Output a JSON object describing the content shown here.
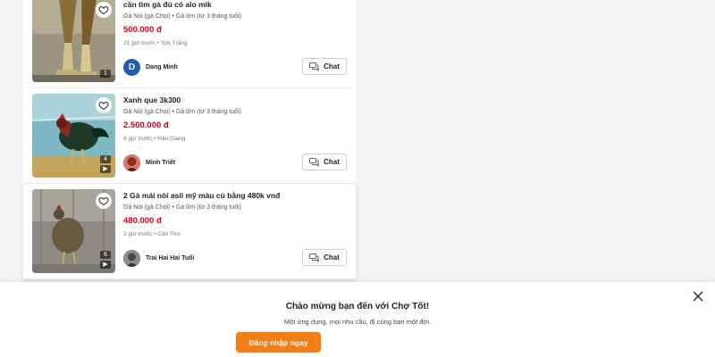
{
  "listings": [
    {
      "title": "cần tìm gà đủ có alo mik",
      "category": "Gà Nòi (gà Chọi)",
      "age": "Gà lớn (từ 3 tháng tuổi)",
      "price": "500.000 đ",
      "time": "21 giờ trước",
      "location": "Sóc Trăng",
      "image_count": "1",
      "has_video": false,
      "seller_name": "Dang Minh",
      "seller_initial": "D",
      "chat_label": "Chat"
    },
    {
      "title": "Xanh que 3k300",
      "category": "Gà Nòi (gà Chọi)",
      "age": "Gà lớn (từ 3 tháng tuổi)",
      "price": "2.500.000 đ",
      "time": "4 giờ trước",
      "location": "Hậu Giang",
      "image_count": "4",
      "has_video": true,
      "seller_name": "Minh Triết",
      "chat_label": "Chat"
    },
    {
      "title": "2 Gà mái nòi asil mỹ màu cù bằng 480k vnđ",
      "category": "Gà Nòi (gà Chọi)",
      "age": "Gà lớn (từ 3 tháng tuổi)",
      "price": "480.000 đ",
      "time": "2 giờ trước",
      "location": "Cần Thơ",
      "image_count": "6",
      "has_video": true,
      "seller_name": "Trai Hai Hai Tuổi",
      "chat_label": "Chat"
    }
  ],
  "separator": "•",
  "welcome": {
    "title": "Chào mừng bạn đến với Chợ Tốt!",
    "subtitle": "Một ứng dụng, mọi nhu cầu, đi cùng bạn một đời.",
    "login_label": "Đăng nhập ngay"
  },
  "colors": {
    "price": "#d0021b",
    "accent": "#f57d16",
    "avatar_d": "#1f5fa8"
  },
  "icons": [
    "heart-icon",
    "chat-icon",
    "video-icon",
    "close-icon"
  ]
}
